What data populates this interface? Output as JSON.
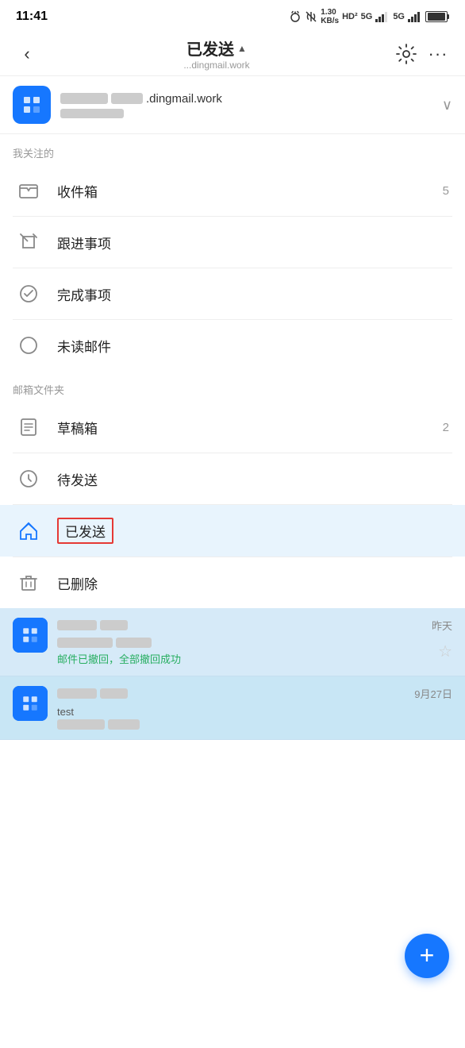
{
  "status": {
    "time": "11:41",
    "icons": "🔔🔕 1.30 KB/s HD² 5G 5G 100"
  },
  "header": {
    "back_label": "‹",
    "title": "已发送",
    "title_arrow": "▲",
    "subtitle": "...dingmail.work",
    "settings_label": "⚙",
    "more_label": "···"
  },
  "account": {
    "email_suffix": ".dingmail.work",
    "chevron": "∨"
  },
  "sections": {
    "followed": "我关注的",
    "folders": "邮箱文件夹"
  },
  "menu_items_followed": [
    {
      "id": "inbox",
      "label": "收件箱",
      "badge": "5",
      "active": false
    },
    {
      "id": "followup",
      "label": "跟进事项",
      "badge": "",
      "active": false
    },
    {
      "id": "done",
      "label": "完成事项",
      "badge": "",
      "active": false
    },
    {
      "id": "unread",
      "label": "未读邮件",
      "badge": "",
      "active": false
    }
  ],
  "menu_items_folders": [
    {
      "id": "drafts",
      "label": "草稿箱",
      "badge": "2",
      "active": false
    },
    {
      "id": "outbox",
      "label": "待发送",
      "badge": "",
      "active": false
    },
    {
      "id": "sent",
      "label": "已发送",
      "badge": "",
      "active": true
    },
    {
      "id": "deleted",
      "label": "已删除",
      "badge": "",
      "active": false
    }
  ],
  "mail_items": [
    {
      "date": "昨天",
      "recall_text": "邮件已撤回，全部撤回成功",
      "has_star": true
    },
    {
      "date": "9月27日",
      "subject_hint": "test",
      "has_star": false
    }
  ],
  "fab": {
    "label": "+"
  }
}
